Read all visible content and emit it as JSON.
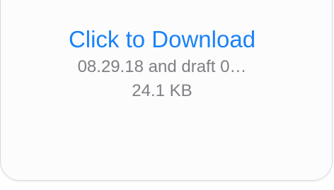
{
  "attachment": {
    "download_label": "Click to Download",
    "file_name": "08.29.18 and draft 0…",
    "file_size": "24.1 KB"
  },
  "colors": {
    "link": "#1a82f7",
    "secondary_text": "#7f7f84",
    "card_background": "#fcfcfd",
    "card_border": "#d9d9de"
  }
}
